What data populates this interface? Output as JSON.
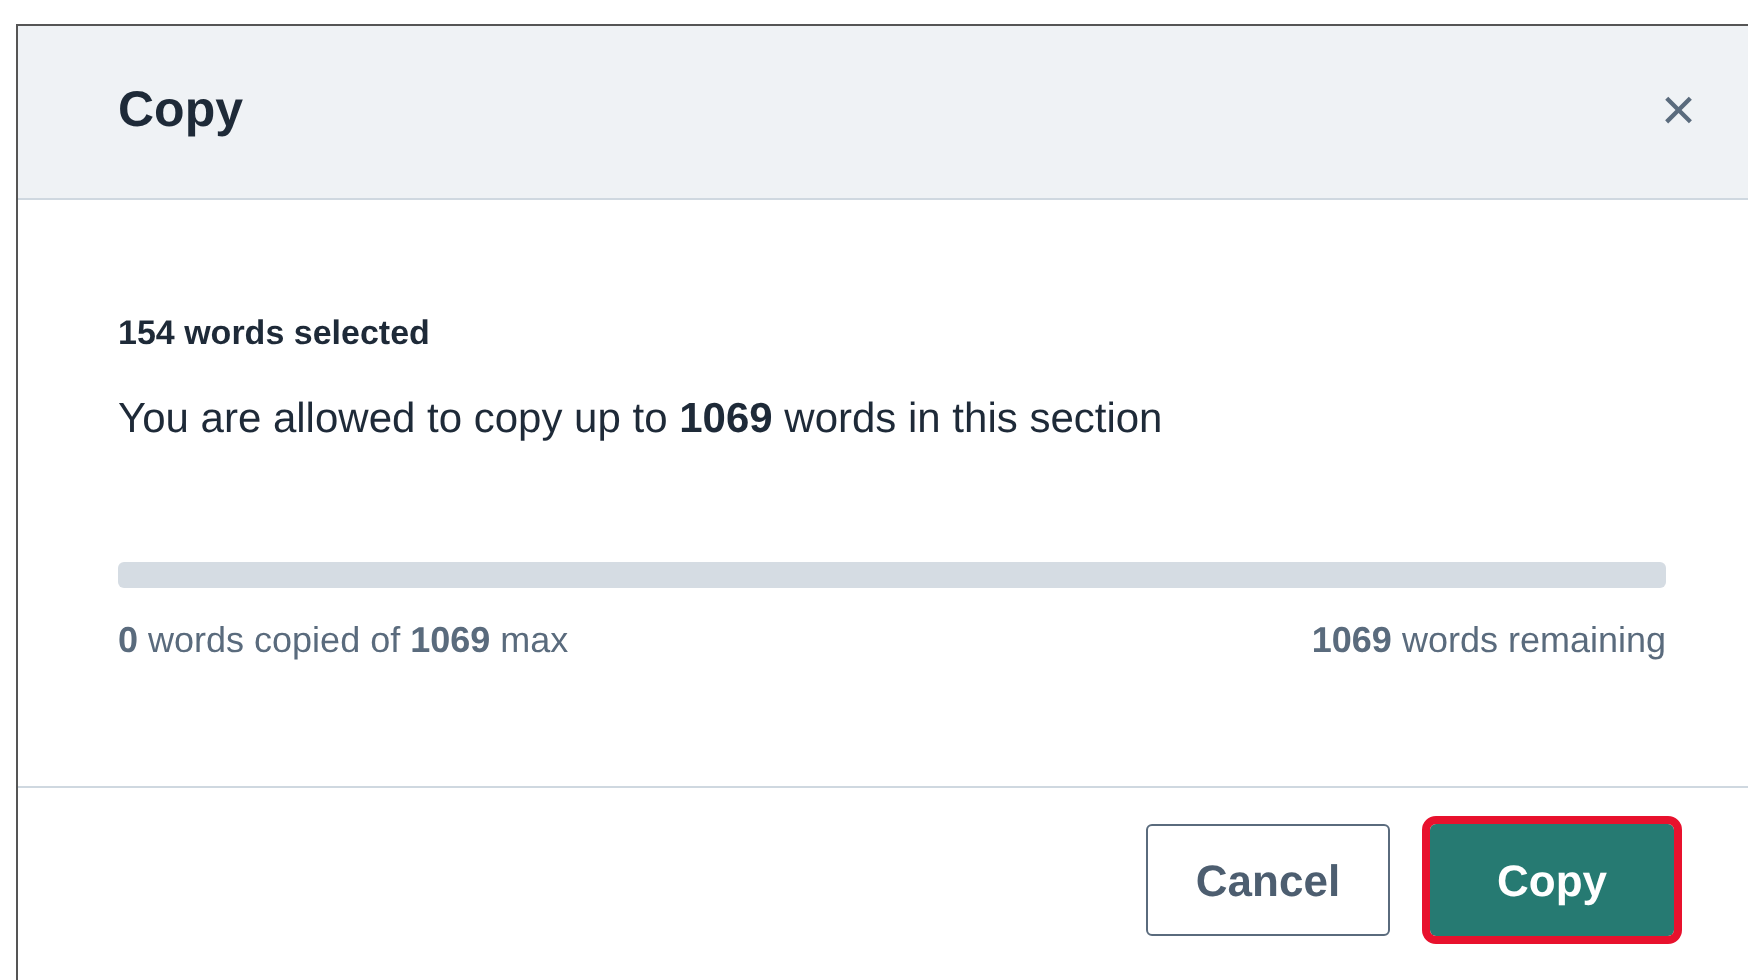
{
  "dialog": {
    "title": "Copy",
    "close": "×"
  },
  "summary": "154 words selected",
  "message": "You are allowed to copy up to **1069** words in this section",
  "progress": {
    "level": 0,
    "copied_label": "**0** words copied of **1069** max",
    "remaining_label": "**1069** words remaining"
  },
  "buttons": [
    {
      "label": "Cancel",
      "kind": "secondary",
      "highlighted": false
    },
    {
      "label": "Copy",
      "kind": "primary",
      "highlighted": true
    }
  ]
}
